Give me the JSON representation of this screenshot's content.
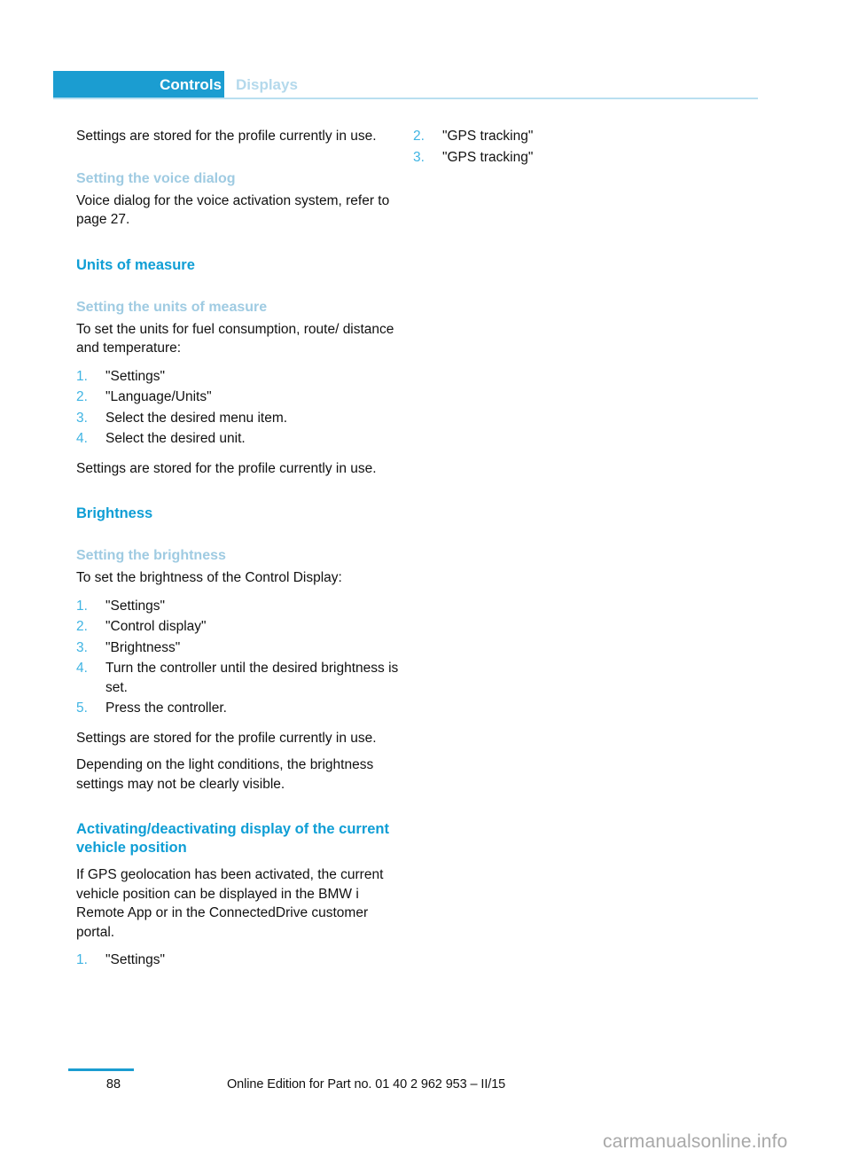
{
  "header": {
    "active_tab": "Controls",
    "inactive_tab": "Displays"
  },
  "left_column": {
    "blocks": [
      {
        "type": "paragraph",
        "text": "Settings are stored for the profile currently in use."
      },
      {
        "type": "h2",
        "text": "Setting the voice dialog"
      },
      {
        "type": "paragraph",
        "text": "Voice dialog for the voice activation system, refer to page 27."
      },
      {
        "type": "h1",
        "text": "Units of measure"
      },
      {
        "type": "h2",
        "text": "Setting the units of measure"
      },
      {
        "type": "paragraph",
        "text": "To set the units for fuel consumption, route/ distance and temperature:"
      },
      {
        "type": "list",
        "items": [
          {
            "num": "1.",
            "text": "\"Settings\""
          },
          {
            "num": "2.",
            "text": "\"Language/Units\""
          },
          {
            "num": "3.",
            "text": "Select the desired menu item."
          },
          {
            "num": "4.",
            "text": "Select the desired unit."
          }
        ]
      },
      {
        "type": "paragraph",
        "text": "Settings are stored for the profile currently in use."
      },
      {
        "type": "h1",
        "text": "Brightness"
      },
      {
        "type": "h2",
        "text": "Setting the brightness"
      },
      {
        "type": "paragraph",
        "text": "To set the brightness of the Control Display:"
      },
      {
        "type": "list",
        "items": [
          {
            "num": "1.",
            "text": "\"Settings\""
          },
          {
            "num": "2.",
            "text": "\"Control display\""
          },
          {
            "num": "3.",
            "text": "\"Brightness\""
          },
          {
            "num": "4.",
            "text": "Turn the controller until the desired brightness is set."
          },
          {
            "num": "5.",
            "text": "Press the controller."
          }
        ]
      },
      {
        "type": "paragraph",
        "text": "Settings are stored for the profile currently in use."
      },
      {
        "type": "paragraph",
        "text": "Depending on the light conditions, the brightness settings may not be clearly visible."
      },
      {
        "type": "h1",
        "text": "Activating/deactivating display of the current vehicle position"
      },
      {
        "type": "paragraph",
        "text": "If GPS geolocation has been activated, the current vehicle position can be displayed in the BMW i Remote App or in the ConnectedDrive customer portal."
      },
      {
        "type": "list",
        "items": [
          {
            "num": "1.",
            "text": "\"Settings\""
          }
        ]
      }
    ]
  },
  "right_column": {
    "blocks": [
      {
        "type": "list",
        "items": [
          {
            "num": "2.",
            "text": "\"GPS tracking\""
          },
          {
            "num": "3.",
            "text": "\"GPS tracking\""
          }
        ]
      }
    ]
  },
  "footer": {
    "page_number": "88",
    "edition": "Online Edition for Part no. 01 40 2 962 953 – II/15"
  },
  "watermark": "carmanualsonline.info",
  "colors": {
    "tab_active_bg": "#1b9dd1",
    "tab_inactive_text": "#b4d9ec",
    "heading_primary": "#0f9ed5",
    "heading_secondary": "#9fcbe2",
    "list_number": "#3fb4e3",
    "header_rule": "#b9dff0",
    "footer_rule": "#1b9dd1",
    "body_text": "#111111",
    "watermark": "#a8a8a8"
  }
}
